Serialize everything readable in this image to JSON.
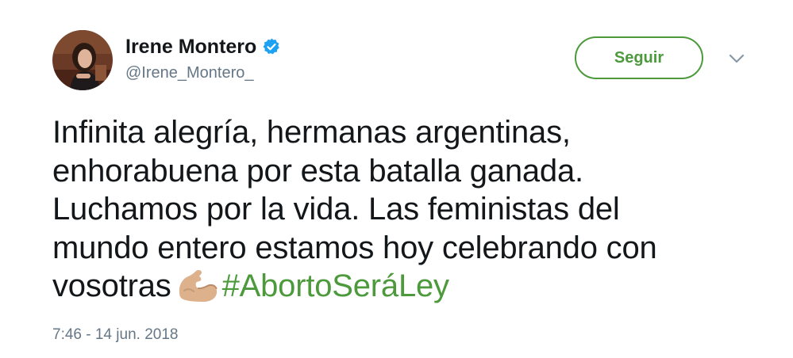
{
  "author": {
    "name": "Irene Montero",
    "handle": "@Irene_Montero_",
    "verified": true
  },
  "actions": {
    "follow_label": "Seguir"
  },
  "tweet": {
    "lines": [
      "Infinita alegría, hermanas argentinas,",
      "enhorabuena por esta batalla ganada.",
      "Luchamos por la vida. Las feministas del",
      "mundo entero estamos hoy celebrando con"
    ],
    "last_line_text": "vosotras",
    "emoji": "flexed-biceps-medium-light-skin-tone",
    "hashtag": "#AbortoSeráLey"
  },
  "timestamp": "7:46 - 14 jun. 2018",
  "colors": {
    "accent": "#4c9a3c",
    "verified_blue": "#1da1f2",
    "text": "#14171a",
    "muted": "#657786"
  }
}
